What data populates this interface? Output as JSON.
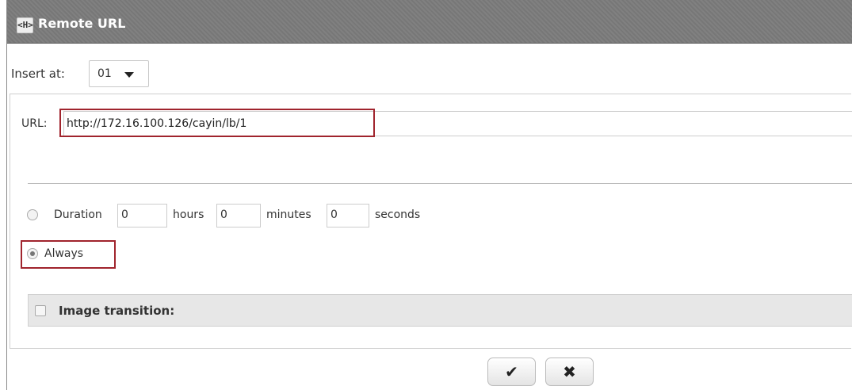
{
  "dialog": {
    "title": "Remote URL",
    "title_icon": "html-tag-icon",
    "title_icon_glyph": "<H>"
  },
  "insert": {
    "label": "Insert at:",
    "selected": "01"
  },
  "url": {
    "label": "URL:",
    "value": "http://172.16.100.126/cayin/lb/1"
  },
  "duration": {
    "option_label": "Duration",
    "hours_value": "0",
    "hours_label": "hours",
    "minutes_value": "0",
    "minutes_label": "minutes",
    "seconds_value": "0",
    "seconds_label": "seconds",
    "selected": false
  },
  "always": {
    "option_label": "Always",
    "selected": true
  },
  "transition": {
    "label": "Image transition:",
    "checked": false
  },
  "actions": {
    "confirm_icon": "check-icon",
    "confirm_glyph": "✔",
    "cancel_icon": "x-icon",
    "cancel_glyph": "✖"
  },
  "colors": {
    "titlebar": "#777777",
    "highlight": "#a0242d"
  }
}
